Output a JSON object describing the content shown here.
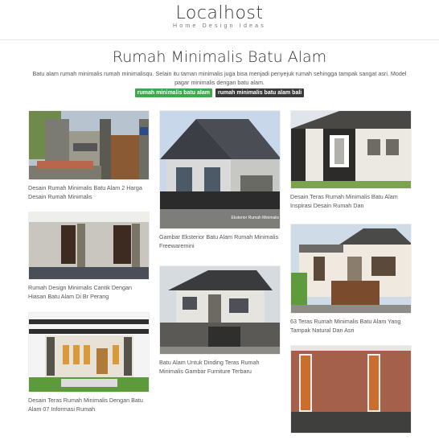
{
  "site": {
    "title": "Localhost",
    "tagline": "Home Design Ideas"
  },
  "post": {
    "title": "Rumah Minimalis Batu Alam",
    "description": "Batu alam rumah minimalis rumah minimalisqu. Selain itu taman minimalis juga bisa menjadi penyejuk rumah sehingga tampak sangat asri. Model pagar minimalis dengan batu alam.",
    "tags": [
      "rumah minimalis batu alam",
      "rumah minimalis batu alam bali"
    ]
  },
  "gallery": [
    {
      "caption": "Desain Rumah Minimalis Batu Alam 2 Harga Desain Rumah Minimalis"
    },
    {
      "caption": "Rumah Design Minimalis Cantik Dengan Hiasan Batu Alam Di Br Perang"
    },
    {
      "caption": "Desain Teras Rumah Minimalis Dengan Batu Alam 07 Informasi Rumah"
    },
    {
      "caption": "Gambar Eksterior Batu Alam Rumah Minimalis Freewaremini",
      "watermark": "Eksterior Rumah Minimalis"
    },
    {
      "caption": "Batu Alam Untuk Dinding Teras Rumah Minimalis Gambar Furniture Terbaru"
    },
    {
      "caption": "Desain Teras Rumah Minimalis Batu Alam Inspirasi Desain Rumah Dan"
    },
    {
      "caption": "63 Teras Rumah Minimalis Batu Alam Yang Tampak Natural Dan Asri"
    },
    {
      "caption": ""
    }
  ],
  "colors": {
    "tag_green": "#3ea84a",
    "tag_dark": "#3a3a3a"
  }
}
